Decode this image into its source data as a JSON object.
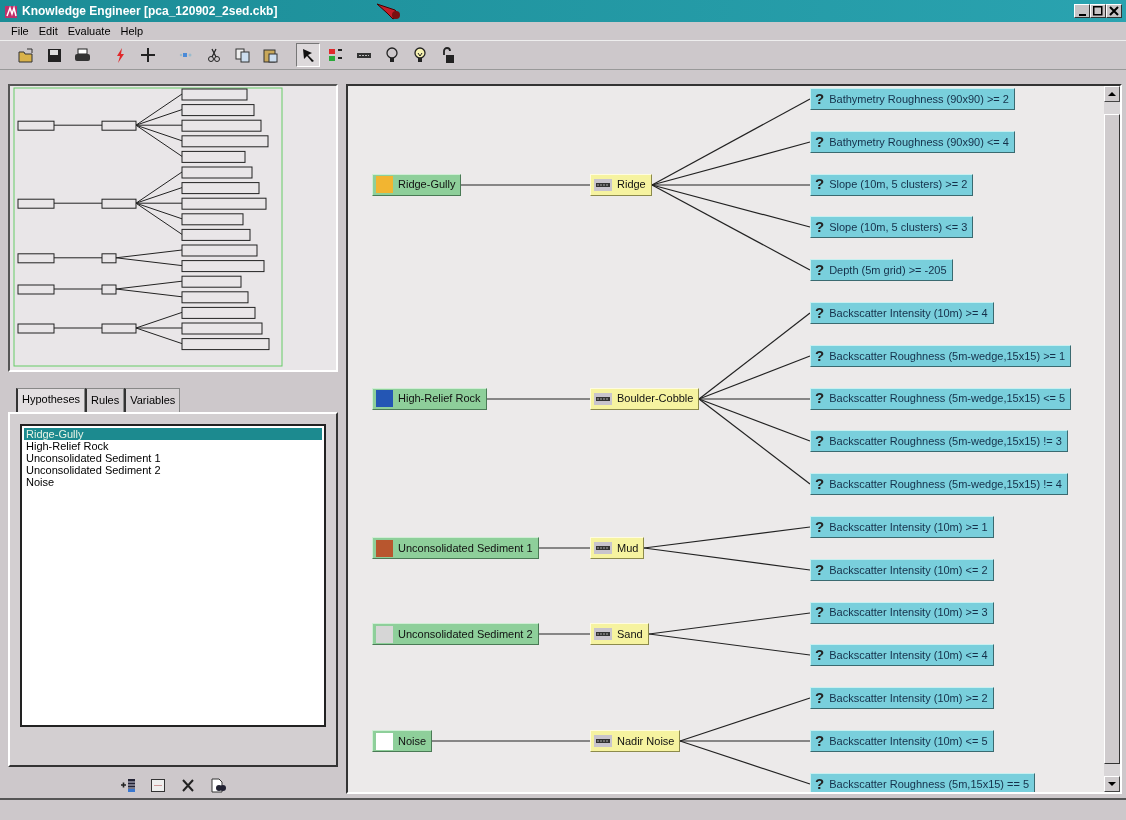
{
  "window": {
    "title": "Knowledge Engineer [pca_120902_2sed.ckb]"
  },
  "menu": [
    {
      "label": "File"
    },
    {
      "label": "Edit"
    },
    {
      "label": "Evaluate"
    },
    {
      "label": "Help"
    }
  ],
  "toolbar": [
    {
      "kind": "open",
      "selected": false
    },
    {
      "kind": "save",
      "selected": false
    },
    {
      "kind": "print",
      "selected": false
    },
    {
      "kind": "lightning",
      "selected": false
    },
    {
      "kind": "plus",
      "selected": false
    },
    {
      "kind": "sparkle",
      "selected": false
    },
    {
      "kind": "cut",
      "selected": false
    },
    {
      "kind": "copy",
      "selected": false
    },
    {
      "kind": "paste",
      "selected": false
    },
    {
      "kind": "pointer",
      "selected": true
    },
    {
      "kind": "legend",
      "selected": false
    },
    {
      "kind": "rule",
      "selected": false
    },
    {
      "kind": "bulb",
      "selected": false
    },
    {
      "kind": "bulb-lit",
      "selected": false
    },
    {
      "kind": "lock",
      "selected": false
    }
  ],
  "tabs": [
    {
      "label": "Hypotheses",
      "selected": true
    },
    {
      "label": "Rules",
      "selected": false
    },
    {
      "label": "Variables",
      "selected": false
    }
  ],
  "hypothesis_list": [
    {
      "label": "Ridge-Gully",
      "selected": true
    },
    {
      "label": "High-Relief Rock",
      "selected": false
    },
    {
      "label": "Unconsolidated Sediment 1",
      "selected": false
    },
    {
      "label": "Unconsolidated Sediment 2",
      "selected": false
    },
    {
      "label": "Noise",
      "selected": false
    }
  ],
  "list_tools": [
    {
      "kind": "add"
    },
    {
      "kind": "window"
    },
    {
      "kind": "delete"
    },
    {
      "kind": "find"
    }
  ],
  "diagram": {
    "hypotheses": [
      {
        "label": "Ridge-Gully",
        "color": "#f2b531",
        "rules": [
          {
            "label": "Ridge",
            "conditions": [
              {
                "symbol": "?",
                "label": "Bathymetry Roughness (90x90) >= 2"
              },
              {
                "symbol": "?",
                "label": "Bathymetry Roughness (90x90) <= 4"
              },
              {
                "symbol": "?",
                "label": "Slope (10m, 5 clusters) >= 2"
              },
              {
                "symbol": "?",
                "label": "Slope (10m, 5 clusters) <= 3"
              },
              {
                "symbol": "?",
                "label": "Depth (5m grid) >= -205"
              }
            ]
          }
        ]
      },
      {
        "label": "High-Relief Rock",
        "color": "#2456b4",
        "rules": [
          {
            "label": "Boulder-Cobble",
            "conditions": [
              {
                "symbol": "?",
                "label": "Backscatter Intensity (10m) >= 4"
              },
              {
                "symbol": "?",
                "label": "Backscatter Roughness (5m-wedge,15x15) >= 1"
              },
              {
                "symbol": "?",
                "label": "Backscatter Roughness (5m-wedge,15x15) <= 5"
              },
              {
                "symbol": "?",
                "label": "Backscatter Roughness (5m-wedge,15x15) != 3"
              },
              {
                "symbol": "?",
                "label": "Backscatter Roughness (5m-wedge,15x15) != 4"
              }
            ]
          }
        ]
      },
      {
        "label": "Unconsolidated Sediment 1",
        "color": "#b8562e",
        "rules": [
          {
            "label": "Mud",
            "conditions": [
              {
                "symbol": "?",
                "label": "Backscatter Intensity (10m) >= 1"
              },
              {
                "symbol": "?",
                "label": "Backscatter Intensity (10m) <= 2"
              }
            ]
          }
        ]
      },
      {
        "label": "Unconsolidated Sediment 2",
        "color": "#d6d6d6",
        "rules": [
          {
            "label": "Sand",
            "conditions": [
              {
                "symbol": "?",
                "label": "Backscatter Intensity (10m) >= 3"
              },
              {
                "symbol": "?",
                "label": "Backscatter Intensity (10m) <= 4"
              }
            ]
          }
        ]
      },
      {
        "label": "Noise",
        "color": "#ffffff",
        "rules": [
          {
            "label": "Nadir Noise",
            "conditions": [
              {
                "symbol": "?",
                "label": "Backscatter Intensity (10m) >= 2"
              },
              {
                "symbol": "?",
                "label": "Backscatter Intensity (10m) <= 5"
              },
              {
                "symbol": "?",
                "label": "Backscatter Roughness (5m,15x15) == 5"
              }
            ]
          }
        ]
      }
    ]
  }
}
